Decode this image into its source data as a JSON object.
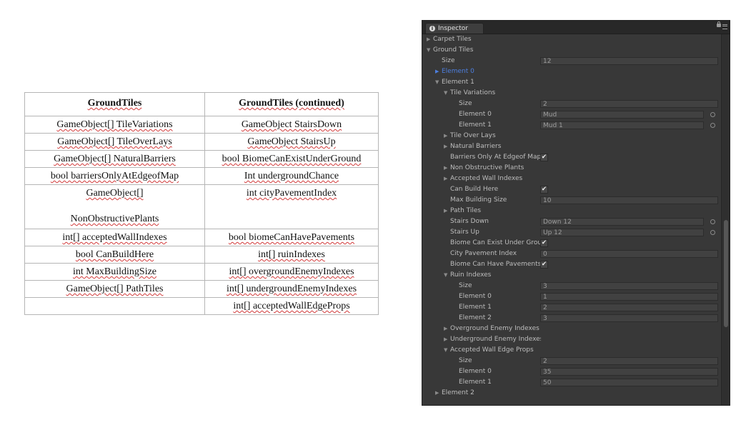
{
  "table": {
    "rows": [
      {
        "c1": "GroundTiles",
        "c2": "GroundTiles (continued)",
        "kind": "head"
      },
      {
        "c1": "GameObject[] TileVariations",
        "c2": "GameObject StairsDown"
      },
      {
        "c1": "GameObject[] TileOverLays",
        "c2": "GameObject StairsUp"
      },
      {
        "c1": "GameObject[] NaturalBarriers",
        "c2": "bool BiomeCanExistUnderGround"
      },
      {
        "c1": "bool barriersOnlyAtEdgeofMap",
        "c2": "Int undergroundChance"
      },
      {
        "c1": "GameObject[]\n\nNonObstructivePlants",
        "c2": "int cityPavementIndex",
        "kind": "tall"
      },
      {
        "c1": "int[] acceptedWallIndexes",
        "c2": "bool biomeCanHavePavements"
      },
      {
        "c1": "bool CanBuildHere",
        "c2": "int[] ruinIndexes"
      },
      {
        "c1": "int MaxBuildingSize",
        "c2": "int[] overgroundEnemyIndexes"
      },
      {
        "c1": "GameObject[] PathTiles",
        "c2": "int[] undergroundEnemyIndexes"
      },
      {
        "c1": "",
        "c2": "int[] acceptedWallEdgeProps"
      }
    ]
  },
  "inspector": {
    "tab_label": "Inspector",
    "icons": {
      "tab": "info-icon",
      "lock": "lock-icon",
      "menu": "menu-icon"
    },
    "selected_color": "#4d7fe0",
    "rows": [
      {
        "label": "Carpet Tiles",
        "indent": 0,
        "fold": "closed"
      },
      {
        "label": "Ground Tiles",
        "indent": 0,
        "fold": "open"
      },
      {
        "label": "Size",
        "indent": 1,
        "value": "12"
      },
      {
        "label": "Element 0",
        "indent": 1,
        "fold": "closed",
        "selected": true
      },
      {
        "label": "Element 1",
        "indent": 1,
        "fold": "open"
      },
      {
        "label": "Tile Variations",
        "indent": 2,
        "fold": "open"
      },
      {
        "label": "Size",
        "indent": 3,
        "value": "2"
      },
      {
        "label": "Element 0",
        "indent": 3,
        "value": "Mud",
        "object": true
      },
      {
        "label": "Element 1",
        "indent": 3,
        "value": "Mud 1",
        "object": true
      },
      {
        "label": "Tile Over Lays",
        "indent": 2,
        "fold": "closed"
      },
      {
        "label": "Natural Barriers",
        "indent": 2,
        "fold": "closed"
      },
      {
        "label": "Barriers Only At Edgeof Map",
        "indent": 2,
        "check": true
      },
      {
        "label": "Non Obstructive Plants",
        "indent": 2,
        "fold": "closed"
      },
      {
        "label": "Accepted Wall Indexes",
        "indent": 2,
        "fold": "closed"
      },
      {
        "label": "Can Build Here",
        "indent": 2,
        "check": true
      },
      {
        "label": "Max Building Size",
        "indent": 2,
        "value": "10"
      },
      {
        "label": "Path Tiles",
        "indent": 2,
        "fold": "closed"
      },
      {
        "label": "Stairs Down",
        "indent": 2,
        "value": "Down 12",
        "object": true
      },
      {
        "label": "Stairs Up",
        "indent": 2,
        "value": "Up 12",
        "object": true
      },
      {
        "label": "Biome Can Exist Under Ground",
        "indent": 2,
        "check": true
      },
      {
        "label": "City Pavement Index",
        "indent": 2,
        "value": "0"
      },
      {
        "label": "Biome Can Have Pavements",
        "indent": 2,
        "check": true
      },
      {
        "label": "Ruin Indexes",
        "indent": 2,
        "fold": "open"
      },
      {
        "label": "Size",
        "indent": 3,
        "value": "3"
      },
      {
        "label": "Element 0",
        "indent": 3,
        "value": "1"
      },
      {
        "label": "Element 1",
        "indent": 3,
        "value": "2"
      },
      {
        "label": "Element 2",
        "indent": 3,
        "value": "3"
      },
      {
        "label": "Overground Enemy Indexes",
        "indent": 2,
        "fold": "closed"
      },
      {
        "label": "Underground Enemy Indexes",
        "indent": 2,
        "fold": "closed"
      },
      {
        "label": "Accepted Wall Edge Props",
        "indent": 2,
        "fold": "open"
      },
      {
        "label": "Size",
        "indent": 3,
        "value": "2"
      },
      {
        "label": "Element 0",
        "indent": 3,
        "value": "35"
      },
      {
        "label": "Element 1",
        "indent": 3,
        "value": "50"
      },
      {
        "label": "Element 2",
        "indent": 1,
        "fold": "closed"
      }
    ]
  }
}
